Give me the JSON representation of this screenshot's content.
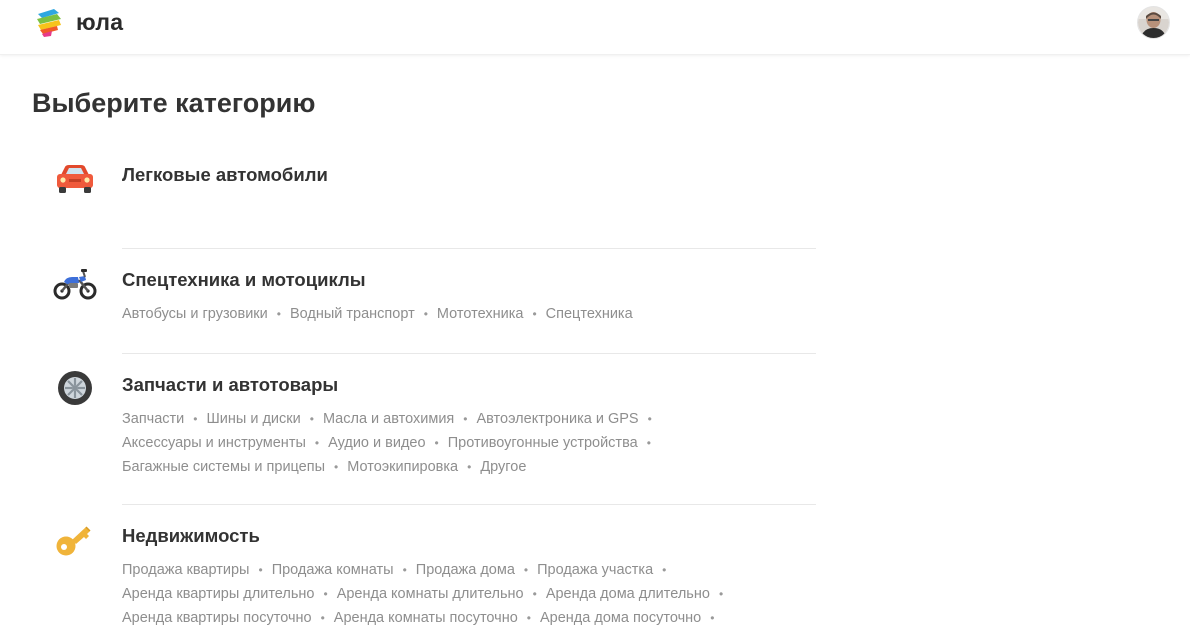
{
  "header": {
    "logo_text": "юла"
  },
  "page": {
    "title": "Выберите категорию"
  },
  "categories": [
    {
      "title": "Легковые автомобили",
      "icon": "car-icon",
      "lines": []
    },
    {
      "title": "Спецтехника и мотоциклы",
      "icon": "motorcycle-icon",
      "lines": [
        [
          "Автобусы и грузовики",
          "Водный транспорт",
          "Мототехника",
          "Спецтехника"
        ]
      ]
    },
    {
      "title": "Запчасти и автотовары",
      "icon": "wheel-icon",
      "lines": [
        [
          "Запчасти",
          "Шины и диски",
          "Масла и автохимия",
          "Автоэлектроника и GPS"
        ],
        [
          "Аксессуары и инструменты",
          "Аудио и видео",
          "Противоугонные устройства"
        ],
        [
          "Багажные системы и прицепы",
          "Мотоэкипировка",
          "Другое"
        ]
      ]
    },
    {
      "title": "Недвижимость",
      "icon": "key-icon",
      "lines": [
        [
          "Продажа квартиры",
          "Продажа комнаты",
          "Продажа дома",
          "Продажа участка"
        ],
        [
          "Аренда квартиры длительно",
          "Аренда комнаты длительно",
          "Аренда дома длительно"
        ],
        [
          "Аренда квартиры посуточно",
          "Аренда комнаты посуточно",
          "Аренда дома посуточно"
        ]
      ]
    }
  ],
  "colors": {
    "car": "#f05a3c",
    "motorcycle": "#3d6fd9",
    "wheel": "#3a3a3a",
    "key": "#f0b43a"
  }
}
